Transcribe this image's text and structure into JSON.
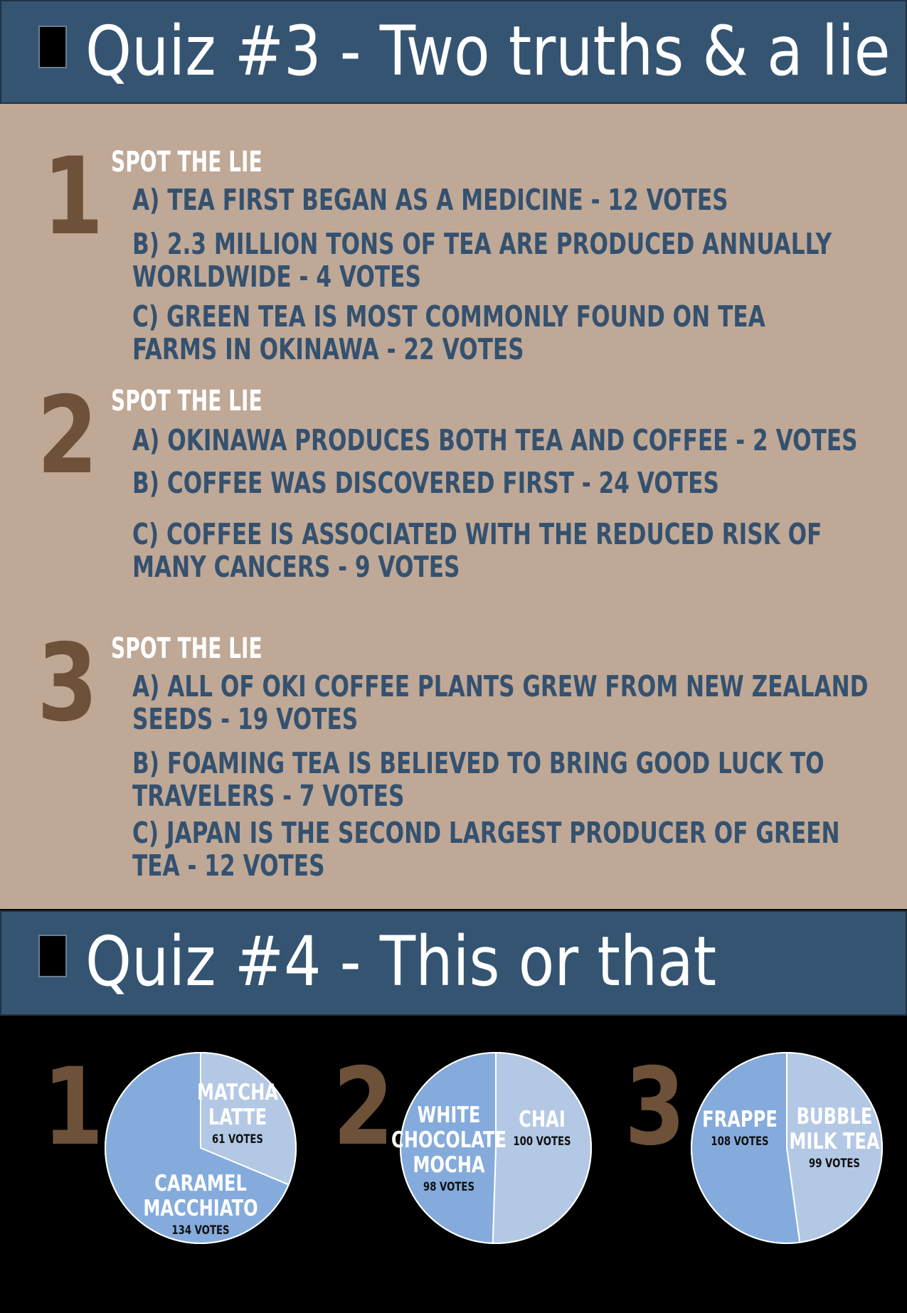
{
  "quiz3": {
    "title": "Quiz #3 - Two truths & a lie",
    "questions": [
      {
        "number": "1",
        "heading": "SPOT THE LIE",
        "options": [
          "A) TEA FIRST BEGAN AS A MEDICINE - 12 VOTES",
          "B) 2.3 MILLION TONS OF TEA ARE PRODUCED ANNUALLY\nWORLDWIDE - 4 VOTES",
          "C) GREEN TEA IS MOST COMMONLY FOUND ON TEA\nFARMS IN OKINAWA - 22 VOTES"
        ]
      },
      {
        "number": "2",
        "heading": "SPOT THE LIE",
        "options": [
          "A) OKINAWA PRODUCES BOTH TEA AND COFFEE - 2 VOTES",
          "B) COFFEE WAS DISCOVERED FIRST - 24 VOTES",
          "C) COFFEE IS ASSOCIATED WITH THE REDUCED RISK OF\nMANY CANCERS - 9 VOTES"
        ]
      },
      {
        "number": "3",
        "heading": "SPOT THE LIE",
        "options": [
          "A) ALL OF OKI COFFEE PLANTS GREW FROM NEW ZEALAND\nSEEDS - 19 VOTES",
          "B) FOAMING TEA IS BELIEVED TO BRING GOOD LUCK TO\nTRAVELERS - 7 VOTES",
          "C) JAPAN IS THE SECOND LARGEST PRODUCER OF GREEN\nTEA - 12 VOTES"
        ]
      }
    ]
  },
  "quiz4": {
    "title": "Quiz #4 - This or that"
  },
  "colors": {
    "banner": "#355472",
    "panel": "#bfa896",
    "number": "#6e5139",
    "option_text": "#34516f",
    "slice_dark": "#84abdc",
    "slice_light": "#b3c8e4"
  },
  "chart_data": [
    {
      "type": "pie",
      "number": "1",
      "slices": [
        {
          "label": "MATCHA LATTE",
          "votes_label": "61 VOTES",
          "value": 61
        },
        {
          "label": "CARAMEL MACCHIATO",
          "votes_label": "134 VOTES",
          "value": 134
        }
      ]
    },
    {
      "type": "pie",
      "number": "2",
      "slices": [
        {
          "label": "CHAI",
          "votes_label": "100 VOTES",
          "value": 100
        },
        {
          "label": "WHITE CHOCOLATE MOCHA",
          "votes_label": "98 VOTES",
          "value": 98
        }
      ]
    },
    {
      "type": "pie",
      "number": "3",
      "slices": [
        {
          "label": "BUBBLE MILK TEA",
          "votes_label": "99 VOTES",
          "value": 99
        },
        {
          "label": "FRAPPE",
          "votes_label": "108 VOTES",
          "value": 108
        }
      ]
    }
  ]
}
